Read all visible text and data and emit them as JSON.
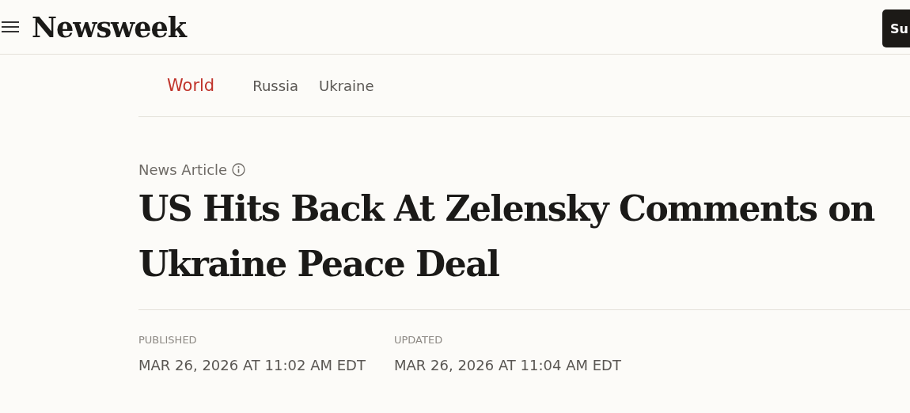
{
  "header": {
    "logo": "Newsweek",
    "subscribe_button": "Su"
  },
  "nav": [
    {
      "label": "World",
      "selected": true
    },
    {
      "label": "Russia",
      "selected": false
    },
    {
      "label": "Ukraine",
      "selected": false
    }
  ],
  "article": {
    "type_label": "News Article",
    "title": "US Hits Back At Zelensky Comments on Ukraine Peace Deal",
    "dates": [
      {
        "label": "PUBLISHED",
        "value": "MAR 26, 2026 AT 11:02 AM EDT"
      },
      {
        "label": "UPDATED",
        "value": "MAR 26, 2026 AT 11:04 AM EDT"
      }
    ]
  }
}
